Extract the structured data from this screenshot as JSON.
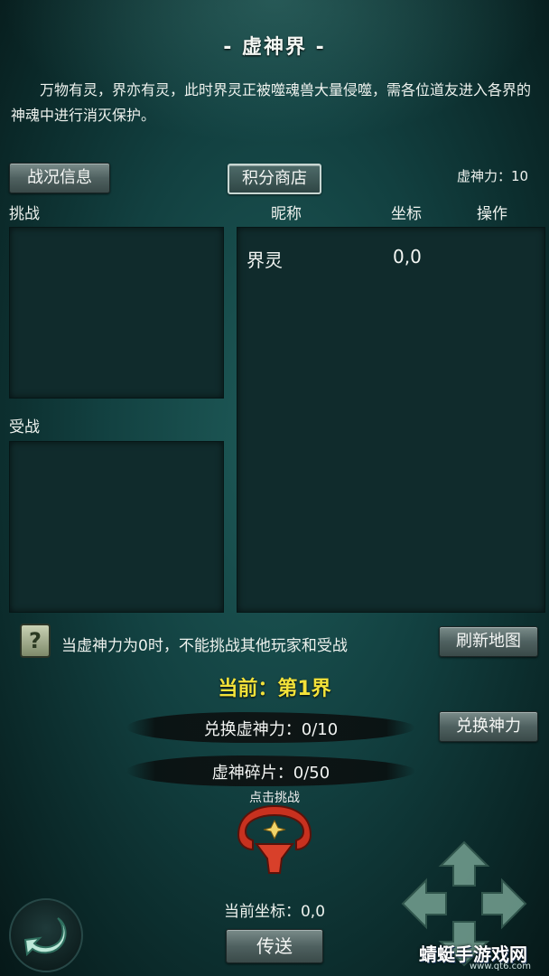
{
  "title": "- 虚神界 -",
  "intro": "万物有灵，界亦有灵，此时界灵正被噬魂兽大量侵噬，需各位道友进入各界的神魂中进行消灭保护。",
  "buttons": {
    "battle_info": "战况信息",
    "points_shop": "积分商店",
    "refresh_map": "刷新地图",
    "exchange_power": "兑换神力",
    "teleport": "传送"
  },
  "power": "虚神力：10",
  "labels": {
    "challenge": "挑战",
    "defend": "受战",
    "nickname": "昵称",
    "coord": "坐标",
    "action": "操作"
  },
  "table_rows": [
    {
      "name": "界灵",
      "coord": "0,0"
    }
  ],
  "warning": "当虚神力为0时，不能挑战其他玩家和受战",
  "help_icon": "?",
  "current_realm": "当前：第1界",
  "exchange_power_status": "兑换虚神力：0/10",
  "fragments_status": "虚神碎片：0/50",
  "click_challenge": "点击挑战",
  "current_coord": "当前坐标：0,0",
  "watermark": {
    "main": "蜻蜓手游戏网",
    "sub": "www.qt6.com"
  },
  "icons": [
    "help-icon",
    "challenge-emblem-icon",
    "back-arrow-icon",
    "dpad-up-icon",
    "dpad-down-icon",
    "dpad-left-icon",
    "dpad-right-icon"
  ],
  "colors": {
    "accent_yellow": "#f3e23a",
    "bg_teal": "#124040"
  }
}
